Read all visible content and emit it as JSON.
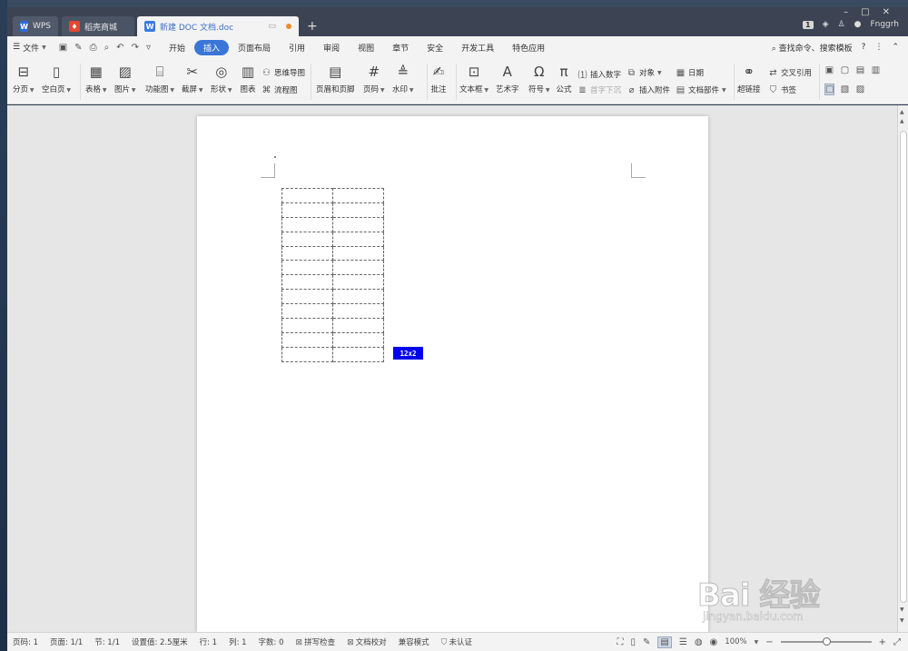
{
  "tabs": [
    {
      "label": "WPS",
      "icon": "wps-logo-icon"
    },
    {
      "label": "稻壳商城",
      "icon": "docer-flame-icon"
    },
    {
      "label": "新建 DOC 文档.doc",
      "icon": "doc-file-icon",
      "active": true
    }
  ],
  "titlebar": {
    "page_badge": "1",
    "user_name": "Fnggrh"
  },
  "menu": {
    "file_label": "文件",
    "tabs": [
      "开始",
      "插入",
      "页面布局",
      "引用",
      "审阅",
      "视图",
      "章节",
      "安全",
      "开发工具",
      "特色应用"
    ],
    "active_tab": "插入",
    "search_label": "查找命令、搜索模板",
    "help_label": "?"
  },
  "ribbon": {
    "page_break": "分页",
    "blank_page": "空白页",
    "table": "表格",
    "picture": "图片",
    "func_chart": "功能图",
    "screenshot": "截屏",
    "shape": "形状",
    "chart": "图表",
    "mindmap": "思维导图",
    "flowchart": "流程图",
    "header_footer": "页眉和页脚",
    "page_number": "页码",
    "watermark": "水印",
    "comment": "批注",
    "textbox": "文本框",
    "wordart": "艺术字",
    "symbol": "符号",
    "formula": "公式",
    "insert_number": "插入数字",
    "drop_cap": "首字下沉",
    "object": "对象",
    "attachment": "插入附件",
    "date": "日期",
    "doc_parts": "文档部件",
    "hyperlink": "超链接",
    "cross_ref": "交叉引用",
    "bookmark": "书签"
  },
  "document": {
    "table_preview": {
      "rows": 12,
      "cols": 2
    },
    "size_label": "12x2"
  },
  "watermark": {
    "main": "Bai 经验",
    "sub": "jingyan.baidu.com"
  },
  "status": {
    "page": "页码: 1",
    "pages": "页面: 1/1",
    "section": "节: 1/1",
    "setting": "设置值: 2.5厘米",
    "row": "行: 1",
    "col": "列: 1",
    "words": "字数: 0",
    "spell": "拼写检查",
    "proof": "文档校对",
    "compat": "兼容模式",
    "cert": "未认证",
    "zoom": "100%",
    "zoom_fraction": 0.5
  },
  "colors": {
    "accent": "#3a76d6",
    "titlebar": "#3c4453",
    "size_label_bg": "#0000ee"
  }
}
